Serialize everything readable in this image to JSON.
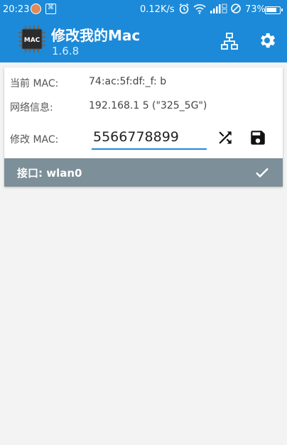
{
  "status_bar": {
    "time": "20:23",
    "app_glyph": "⌘",
    "speed": "0.12K/s",
    "battery": "73%"
  },
  "app_bar": {
    "title": "修改我的Mac",
    "version": "1.6.8",
    "icon_label": "MAC"
  },
  "card": {
    "current_mac_label": "当前 MAC:",
    "current_mac_value": "74:ac:5f:df:_f: b",
    "network_label": "网络信息:",
    "network_value": "192.168.1 5 (\"325_5G\")",
    "modify_label": "修改 MAC:",
    "modify_value": "5566778899",
    "interface_label": "接口: wlan0"
  },
  "colors": {
    "primary": "#1c8ad8",
    "footer": "#7d8f98",
    "background": "#f3f3f3"
  },
  "icons": [
    "network-icon",
    "gear-icon",
    "shuffle-icon",
    "save-icon",
    "check-icon"
  ]
}
